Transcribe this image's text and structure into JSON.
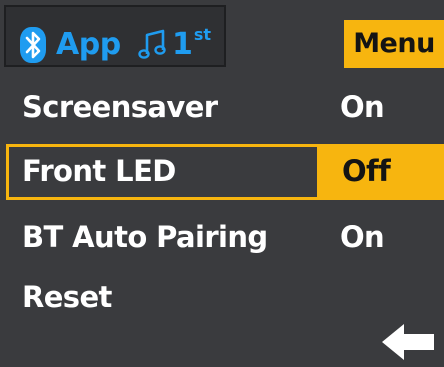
{
  "status": {
    "bluetooth_icon": "bluetooth-icon",
    "source": "App",
    "music_icon": "music-note-icon",
    "track_prefix": "1",
    "track_suffix": "st"
  },
  "menu_tab": {
    "label": "Menu"
  },
  "settings": [
    {
      "label": "Screensaver",
      "value": "On",
      "selected": false
    },
    {
      "label": "Front LED",
      "value": "Off",
      "selected": true
    },
    {
      "label": "BT Auto Pairing",
      "value": "On",
      "selected": false
    },
    {
      "label": "Reset",
      "value": "",
      "selected": false
    }
  ],
  "back_icon": "back-arrow-icon",
  "colors": {
    "background": "#3a3b3e",
    "accent": "#f7b50f",
    "status_blue": "#1f9cf0",
    "text": "#ffffff"
  }
}
